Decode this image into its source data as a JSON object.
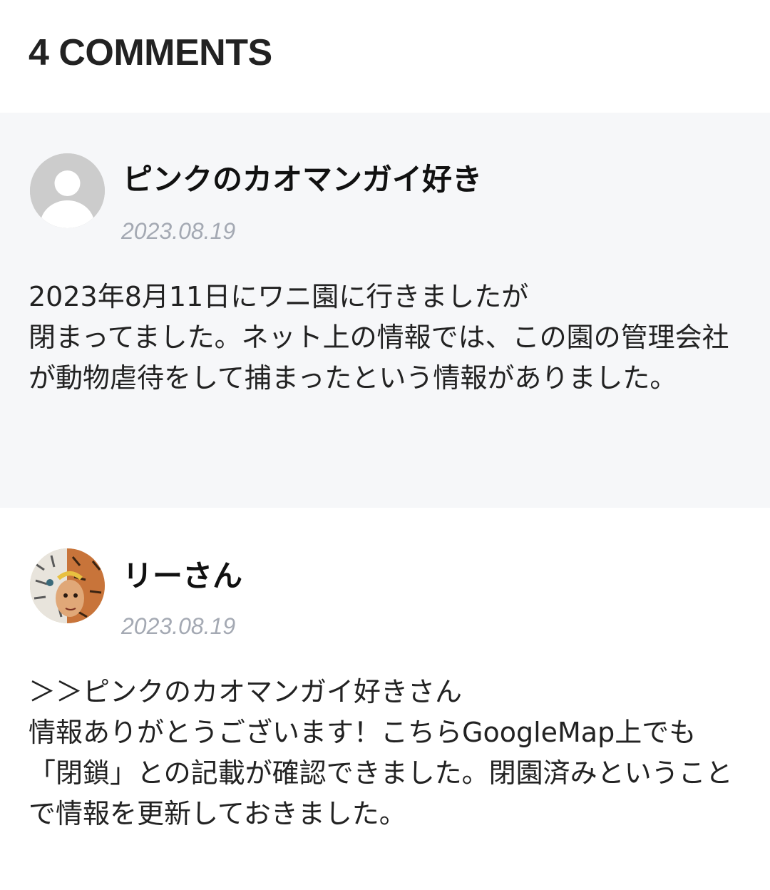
{
  "comments_header": {
    "title": "4 COMMENTS"
  },
  "comments": [
    {
      "author": "ピンクのカオマンガイ好き",
      "date": "2023.08.19",
      "avatar_icon": "default-user-avatar-icon",
      "body_lines": [
        "2023年8月11日にワニ園に行きましたが",
        "閉まってました。ネット上の情報では、この園の管理会社が動物虐待をして捕まったという情報がありました。"
      ]
    },
    {
      "author": "リーさん",
      "date": "2023.08.19",
      "avatar_icon": "illustrated-tiger-face-avatar-icon",
      "body_lines": [
        "＞＞ピンクのカオマンガイ好きさん",
        "情報ありがとうございます！こちらGoogleMap上でも「閉鎖」との記載が確認できました。閉園済みということで情報を更新しておきました。"
      ]
    }
  ],
  "colors": {
    "first_comment_bg": "#f6f7f9",
    "date_text": "#a4a9b3",
    "default_avatar_bg": "#cccccc"
  }
}
